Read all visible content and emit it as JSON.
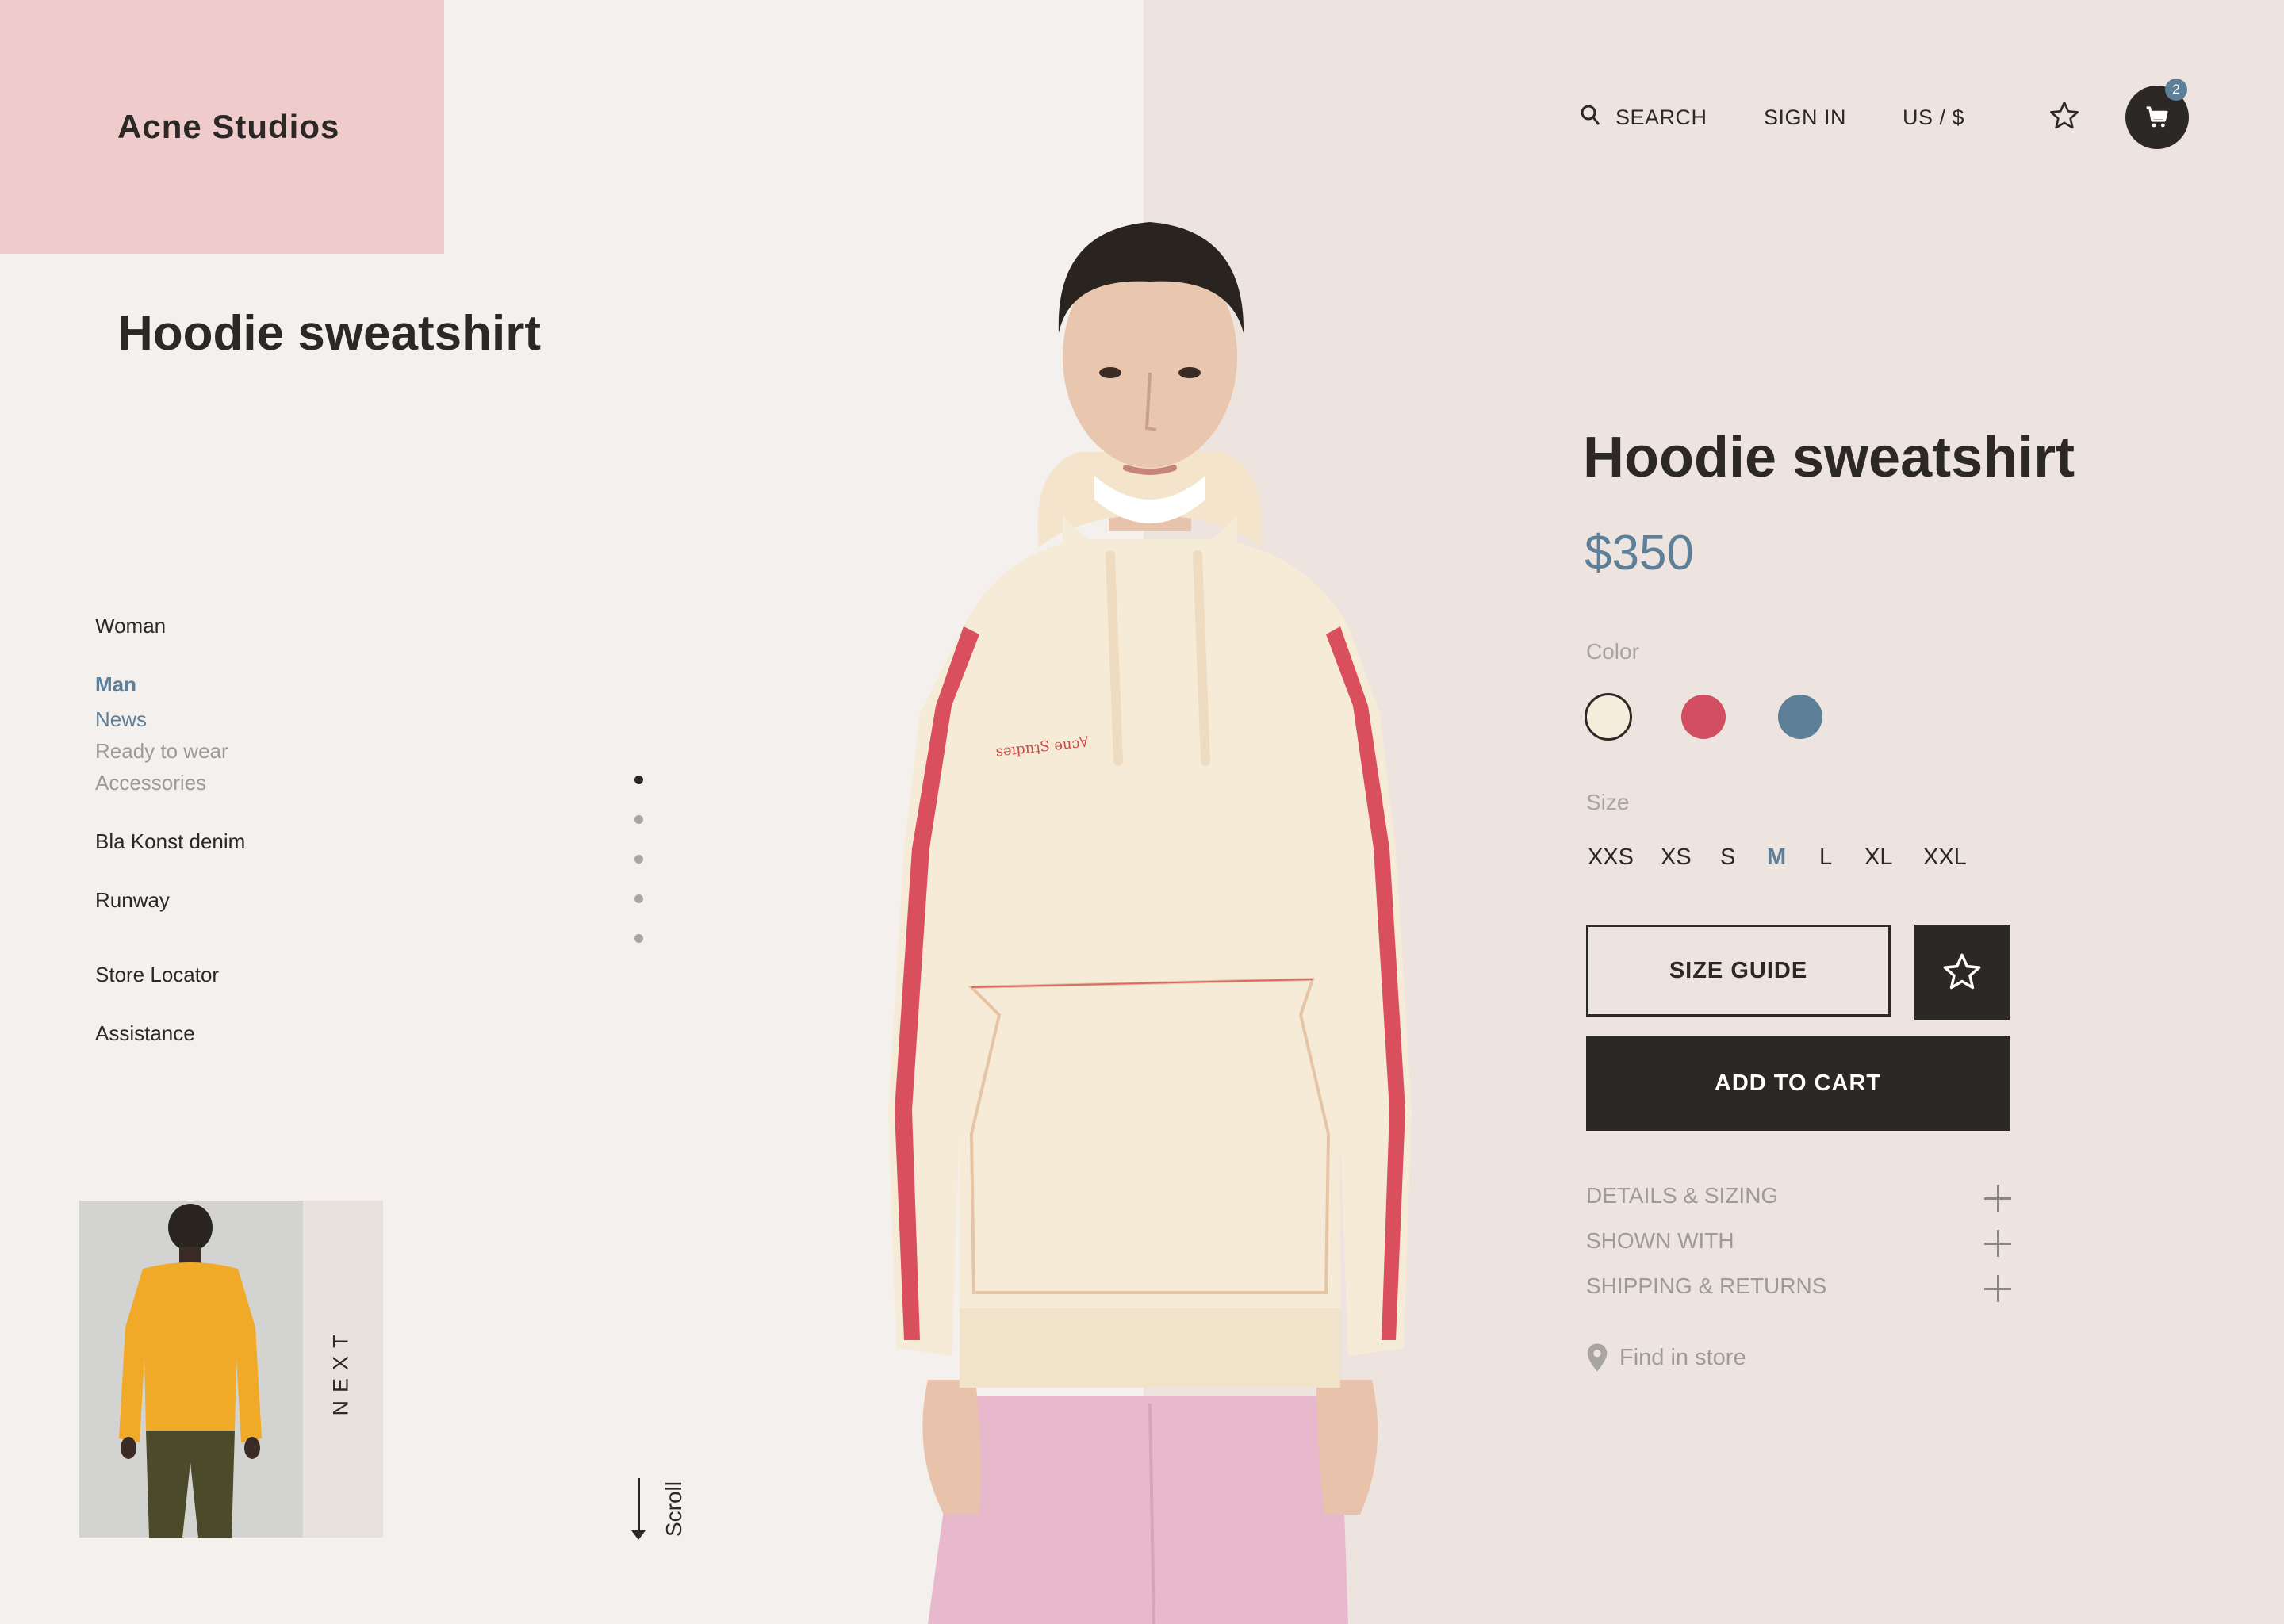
{
  "brand": {
    "name": "Acne Studios"
  },
  "left": {
    "title": "Hoodie sweatshirt"
  },
  "nav": {
    "woman": "Woman",
    "man": "Man",
    "man_sub": [
      "News",
      "Ready to wear",
      "Accessories"
    ],
    "bla_konst": "Bla Konst denim",
    "runway": "Runway",
    "store_locator": "Store Locator",
    "assistance": "Assistance"
  },
  "pager": {
    "count": 5,
    "active": 1
  },
  "next": {
    "label": "NEXT"
  },
  "scroll": {
    "label": "Scroll"
  },
  "header": {
    "search": "SEARCH",
    "sign_in": "SIGN IN",
    "currency": "US / $",
    "cart_count": "2"
  },
  "product": {
    "title": "Hoodie sweatshirt",
    "price": "$350",
    "color_label": "Color",
    "colors": [
      "#f6ecdc",
      "#d24f62",
      "#5e7f98"
    ],
    "selected_color": 0,
    "size_label": "Size",
    "sizes": [
      "XXS",
      "XS",
      "S",
      "M",
      "L",
      "XL",
      "XXL"
    ],
    "selected_size": "M",
    "size_guide": "SIZE GUIDE",
    "add_to_cart": "ADD TO CART",
    "accordions": [
      "DETAILS & SIZING",
      "SHOWN WITH",
      "SHIPPING & RETURNS"
    ],
    "find_in_store": "Find in store"
  },
  "theme": {
    "accent": "#5e7f98",
    "dark": "#2b2826",
    "logo_bg": "#efcccb",
    "right_bg": "#ede4e0"
  }
}
